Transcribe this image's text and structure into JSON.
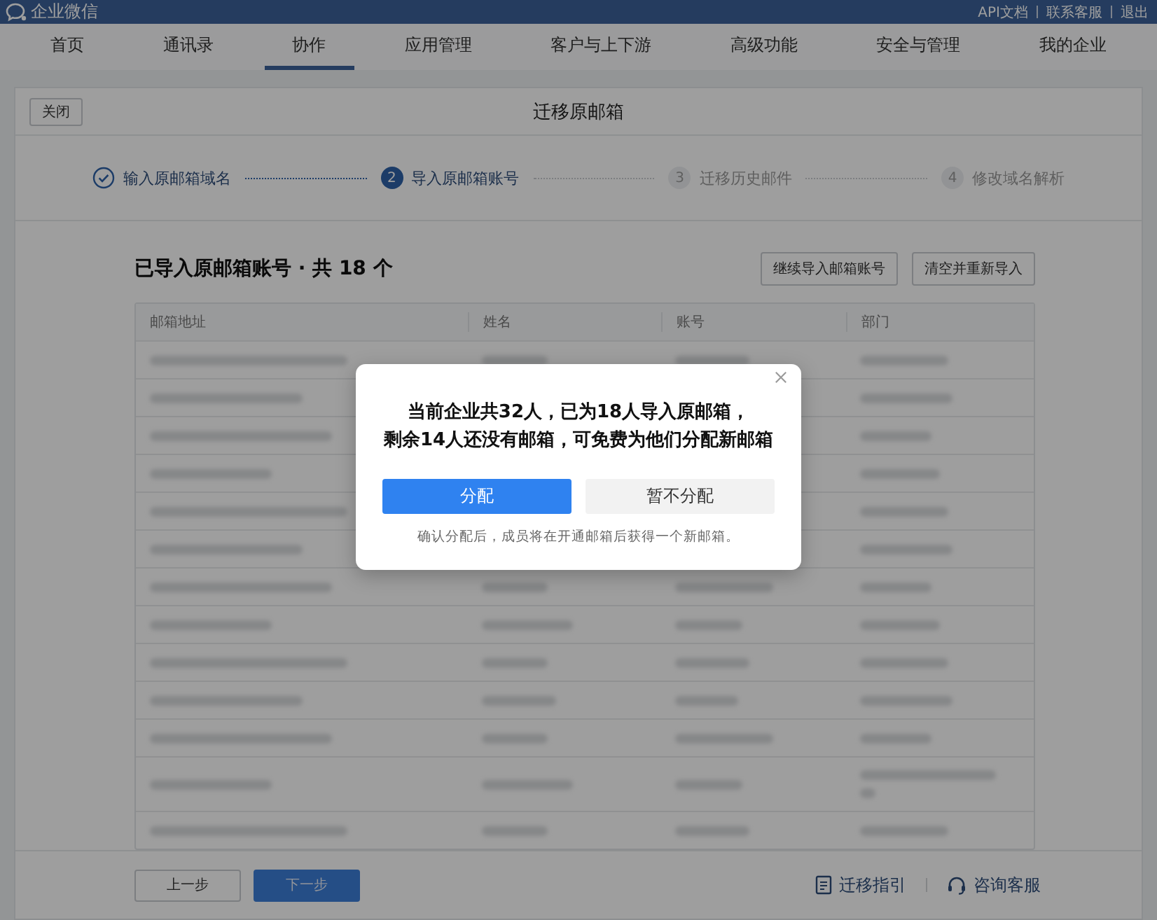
{
  "topbar": {
    "brand": "企业微信",
    "links": [
      "API文档",
      "联系客服",
      "退出"
    ]
  },
  "nav": [
    {
      "label": "首页",
      "selected": false
    },
    {
      "label": "通讯录",
      "selected": false
    },
    {
      "label": "协作",
      "selected": true
    },
    {
      "label": "应用管理",
      "selected": false
    },
    {
      "label": "客户与上下游",
      "selected": false
    },
    {
      "label": "高级功能",
      "selected": false
    },
    {
      "label": "安全与管理",
      "selected": false
    },
    {
      "label": "我的企业",
      "selected": false
    }
  ],
  "header": {
    "close": "关闭",
    "title": "迁移原邮箱"
  },
  "steps": [
    {
      "label": "输入原邮箱域名",
      "done": true,
      "current": false
    },
    {
      "number": "2",
      "label": "导入原邮箱账号",
      "done": false,
      "current": true
    },
    {
      "number": "3",
      "label": "迁移历史邮件",
      "done": false,
      "current": false
    },
    {
      "number": "4",
      "label": "修改域名解析",
      "done": false,
      "current": false
    }
  ],
  "section": {
    "title": "已导入原邮箱账号 · 共 18 个",
    "buttons": [
      "继续导入邮箱账号",
      "清空并重新导入"
    ]
  },
  "table": {
    "columns": [
      "邮箱地址",
      "姓名",
      "账号",
      "部门"
    ],
    "rows": [
      {
        "wrapped": false
      },
      {
        "wrapped": false
      },
      {
        "wrapped": false
      },
      {
        "wrapped": false
      },
      {
        "wrapped": false
      },
      {
        "wrapped": false
      },
      {
        "wrapped": false
      },
      {
        "wrapped": false
      },
      {
        "wrapped": false
      },
      {
        "wrapped": false
      },
      {
        "wrapped": false
      },
      {
        "wrapped": true
      },
      {
        "wrapped": false
      }
    ]
  },
  "footer": {
    "buttons": [
      {
        "label": "上一步",
        "kind": "secondary"
      },
      {
        "label": "下一步",
        "kind": "primary"
      }
    ],
    "links": [
      {
        "label": "迁移指引",
        "kind": "doc"
      },
      {
        "label": "咨询客服",
        "kind": "headset"
      }
    ]
  },
  "dialog": {
    "message": [
      "当前企业共32人，已为18人导入原邮箱，",
      "剩余14人还没有邮箱，可免费为他们分配新邮箱"
    ],
    "buttons": [
      {
        "label": "分配",
        "kind": "primary"
      },
      {
        "label": "暂不分配",
        "kind": "secondary"
      }
    ],
    "note": "确认分配后，成员将在开通邮箱后获得一个新邮箱。"
  }
}
